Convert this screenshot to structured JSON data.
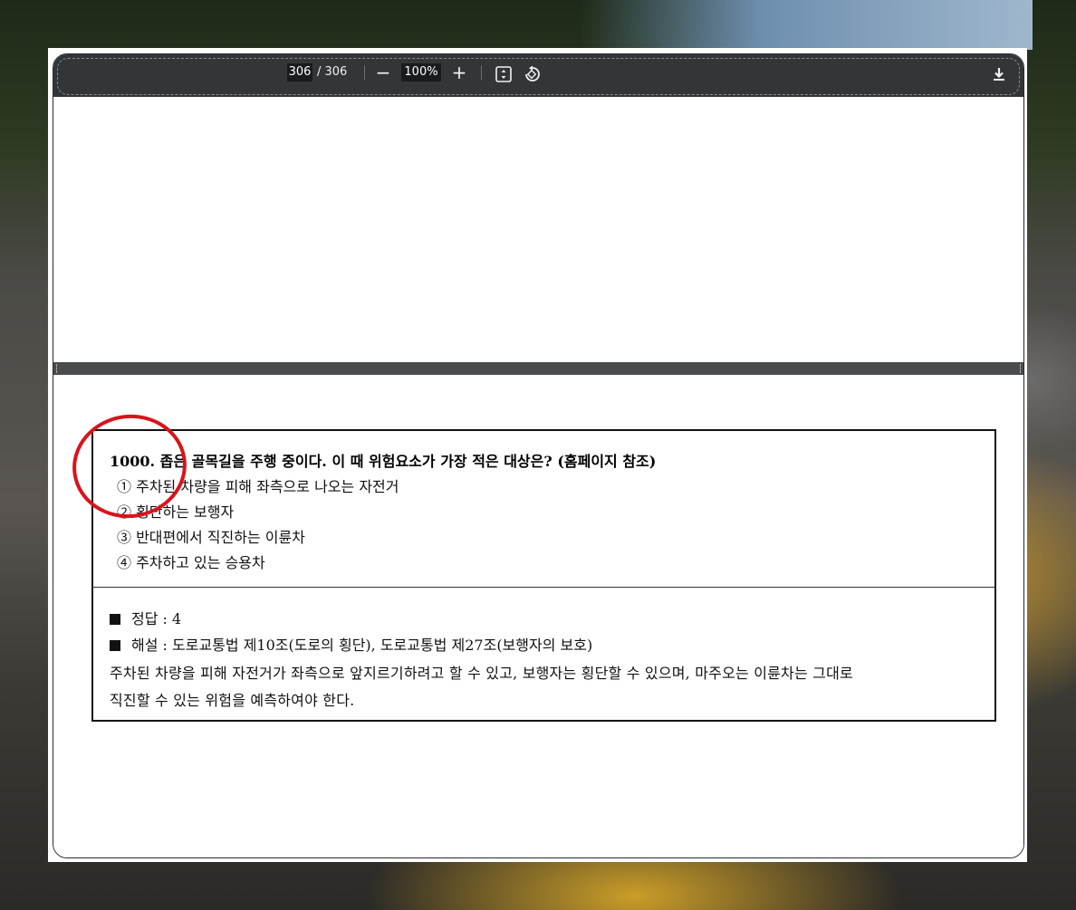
{
  "toolbar": {
    "page_current": "306",
    "page_total": "/ 306",
    "zoom_out": "−",
    "zoom_level": "100%",
    "zoom_in": "+",
    "fit_icon": "fit-page-icon",
    "rotate_icon": "rotate-icon",
    "download_icon": "download-icon"
  },
  "question": {
    "title": "1000. 좁은 골목길을 주행 중이다. 이 때 위험요소가 가장 적은 대상은? (홈페이지 참조)",
    "options": [
      "① 주차된 차량을 피해 좌측으로 나오는 자전거",
      "② 횡단하는 보행자",
      "③ 반대편에서 직진하는 이륜차",
      "④ 주차하고 있는 승용차"
    ]
  },
  "answer": {
    "correct": "정답 : 4",
    "explanation_ref": "해설 : 도로교통법 제10조(도로의 횡단), 도로교통법 제27조(보행자의 보호)",
    "explanation_line1": "주차된 차량을 피해 자전거가 좌측으로 앞지르기하려고 할 수 있고, 보행자는 횡단할 수 있으며, 마주오는 이륜차는 그대로",
    "explanation_line2": "직진할 수 있는 위험을 예측하여야 한다."
  },
  "colors": {
    "toolbar_bg": "#323639",
    "annotation_circle": "#d8141c"
  }
}
